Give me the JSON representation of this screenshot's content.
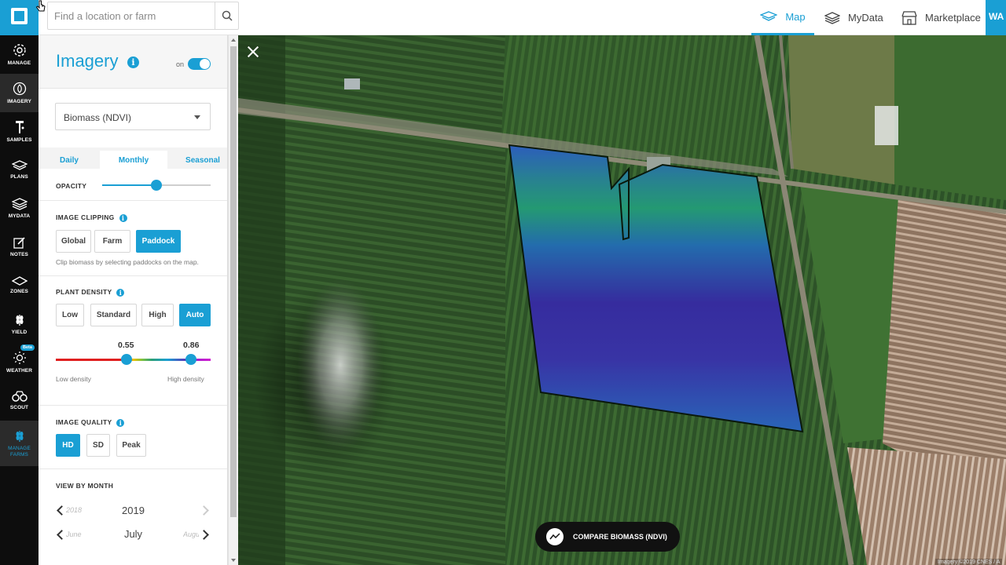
{
  "topbar": {
    "search_placeholder": "Find a location or farm",
    "nav": [
      {
        "label": "Map",
        "active": true
      },
      {
        "label": "MyData",
        "active": false
      },
      {
        "label": "Marketplace",
        "active": false
      }
    ],
    "account_label": "WA"
  },
  "rail": {
    "items": [
      {
        "label": "MANAGE"
      },
      {
        "label": "IMAGERY"
      },
      {
        "label": "SAMPLES"
      },
      {
        "label": "PLANS"
      },
      {
        "label": "MYDATA"
      },
      {
        "label": "NOTES"
      },
      {
        "label": "ZONES"
      },
      {
        "label": "YIELD"
      },
      {
        "label": "WEATHER",
        "badge": "Beta"
      },
      {
        "label": "SCOUT"
      },
      {
        "label": "MANAGE FARMS"
      }
    ]
  },
  "panel": {
    "title": "Imagery",
    "toggle_label": "on",
    "toggle_state": true,
    "layer_select": "Biomass (NDVI)",
    "tabs": [
      "Daily",
      "Monthly",
      "Seasonal"
    ],
    "active_tab": "Monthly",
    "opacity": {
      "label": "OPACITY",
      "value": 0.5
    },
    "clipping": {
      "label": "IMAGE CLIPPING",
      "options": [
        "Global",
        "Farm",
        "Paddock"
      ],
      "selected": "Paddock",
      "note": "Clip biomass by selecting paddocks on the map."
    },
    "density": {
      "label": "PLANT DENSITY",
      "options": [
        "Low",
        "Standard",
        "High",
        "Auto"
      ],
      "selected": "Auto",
      "low_value": "0.55",
      "high_value": "0.86",
      "low_label": "Low density",
      "high_label": "High density"
    },
    "quality": {
      "label": "IMAGE QUALITY",
      "options": [
        "HD",
        "SD",
        "Peak"
      ],
      "selected": "HD"
    },
    "view_by_month": {
      "label": "VIEW BY MONTH",
      "prev_year": "2018",
      "year": "2019",
      "prev_month": "June",
      "month": "July",
      "next_month": "August"
    }
  },
  "map": {
    "compare_label": "COMPARE BIOMASS (NDVI)",
    "attribution": "Imagery ©2019 CNES / A"
  }
}
